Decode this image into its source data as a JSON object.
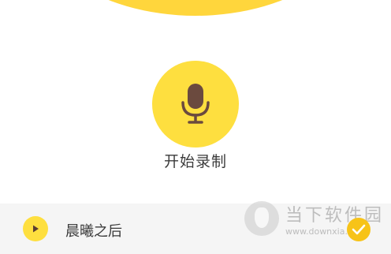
{
  "recorder": {
    "label": "开始录制"
  },
  "recording_item": {
    "title": "晨曦之后"
  },
  "watermark": {
    "brand": "当下软件园",
    "url": "www.downxia.com"
  },
  "colors": {
    "accent": "#FEDF3F",
    "top_arc": "#FFD63C",
    "mic": "#6B4A3E",
    "bar_background": "#F5F5F5",
    "check_badge": "#F7C318"
  },
  "icons": {
    "record": "microphone-icon",
    "play": "play-icon",
    "badge": "check-icon"
  }
}
